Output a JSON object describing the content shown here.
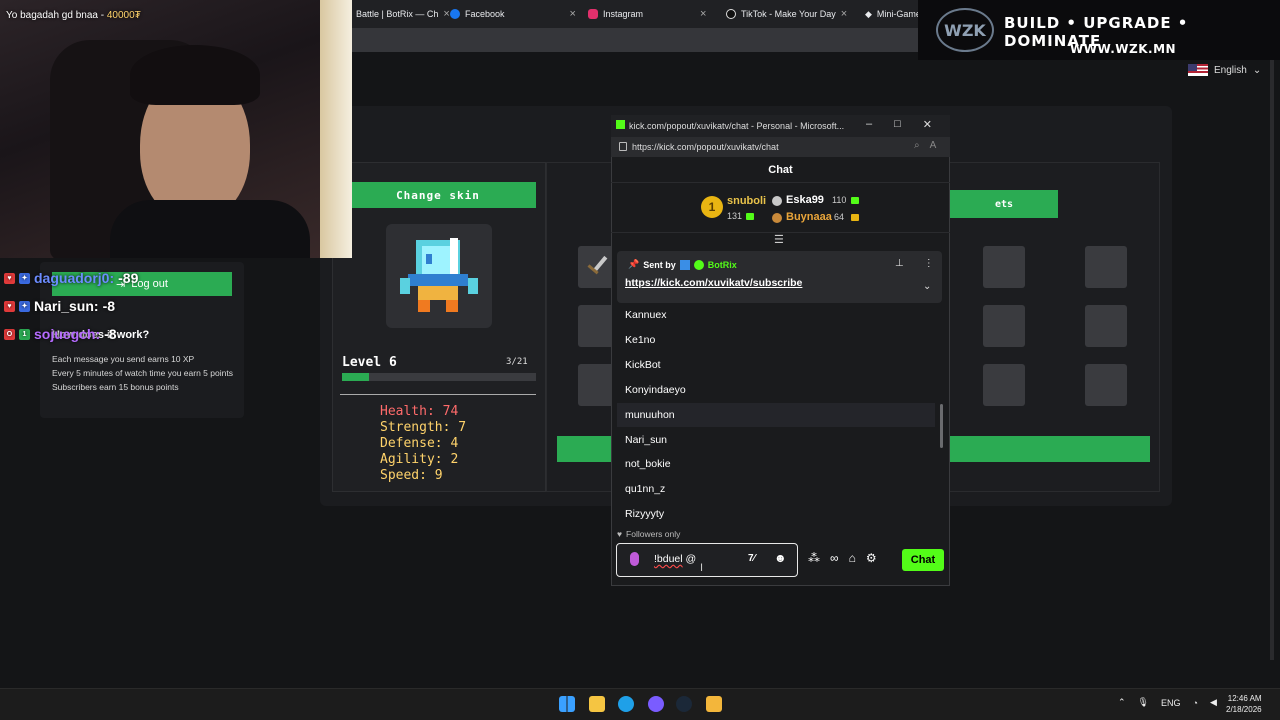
{
  "browser": {
    "tabs": [
      {
        "label": "Battle | BotRix — Ch",
        "icon": "botrix-icon"
      },
      {
        "label": "Facebook",
        "icon": "facebook-icon"
      },
      {
        "label": "Instagram",
        "icon": "instagram-icon"
      },
      {
        "label": "TikTok - Make Your Day",
        "icon": "tiktok-icon"
      },
      {
        "label": "Mini-Game",
        "icon": "minigame-icon"
      }
    ]
  },
  "banner": {
    "logo": "WZK",
    "slogan": "BUILD • UPGRADE • DOMINATE",
    "url": "WWW.WZK.MN"
  },
  "language": {
    "selected": "English"
  },
  "webcam": {
    "overlay_text": "Yo bagadah gd bnaa - ",
    "overlay_points": "40000₮"
  },
  "left_panel": {
    "logout_label": "Log out",
    "how_title": "How does it work?",
    "how_lines": [
      "Each message you send earns 10 XP",
      "Every 5 minutes of watch time you earn 5 points",
      "Subscribers earn 15 bonus points"
    ]
  },
  "duel_overlay": [
    {
      "name": "daguadorj0:",
      "value": "-89"
    },
    {
      "name": "Nari_sun:",
      "value": "-8"
    },
    {
      "name": "sojuegch:",
      "value": "-8"
    }
  ],
  "game": {
    "change_skin_label": "Change skin",
    "sets_label": "ets",
    "level_label": "Level 6",
    "level_progress": "3/21",
    "xp_fraction": 0.14,
    "stats": {
      "health": "Health: 74",
      "strength": "Strength: 7",
      "defense": "Defense: 4",
      "agility": "Agility: 2",
      "speed": "Speed: 9"
    }
  },
  "chat_window": {
    "title": "kick.com/popout/xuvikatv/chat - Personal - Microsoft...",
    "url": "https://kick.com/popout/xuvikatv/chat",
    "header": "Chat",
    "leaderboard": [
      {
        "rank": "1",
        "name": "snuboli",
        "value": "131"
      },
      {
        "rank": "2",
        "name": "Eska99",
        "value": "110"
      },
      {
        "rank": "3",
        "name": "Buynaaa",
        "value": "64"
      }
    ],
    "pinned": {
      "sent_by_label": "Sent by",
      "sender": "BotRix",
      "link": "https://kick.com/xuvikatv/subscribe"
    },
    "user_suggestions": [
      "Kannuex",
      "Ke1no",
      "KickBot",
      "Konyindaeyo",
      "munuuhon",
      "Nari_sun",
      "not_bokie",
      "qu1nn_z",
      "Rizyyyty"
    ],
    "highlighted_index": 4,
    "followers_only": "Followers only",
    "input_value_cmd": "!bduel",
    "input_value_rest": " @",
    "send_label": "Chat"
  },
  "taskbar": {
    "tray_lang": "ENG",
    "time": "12:46 AM",
    "date": "2/18/2026"
  },
  "colors": {
    "accent_green": "#2bab53",
    "kick_green": "#53fc18",
    "gold": "#e9b512"
  }
}
